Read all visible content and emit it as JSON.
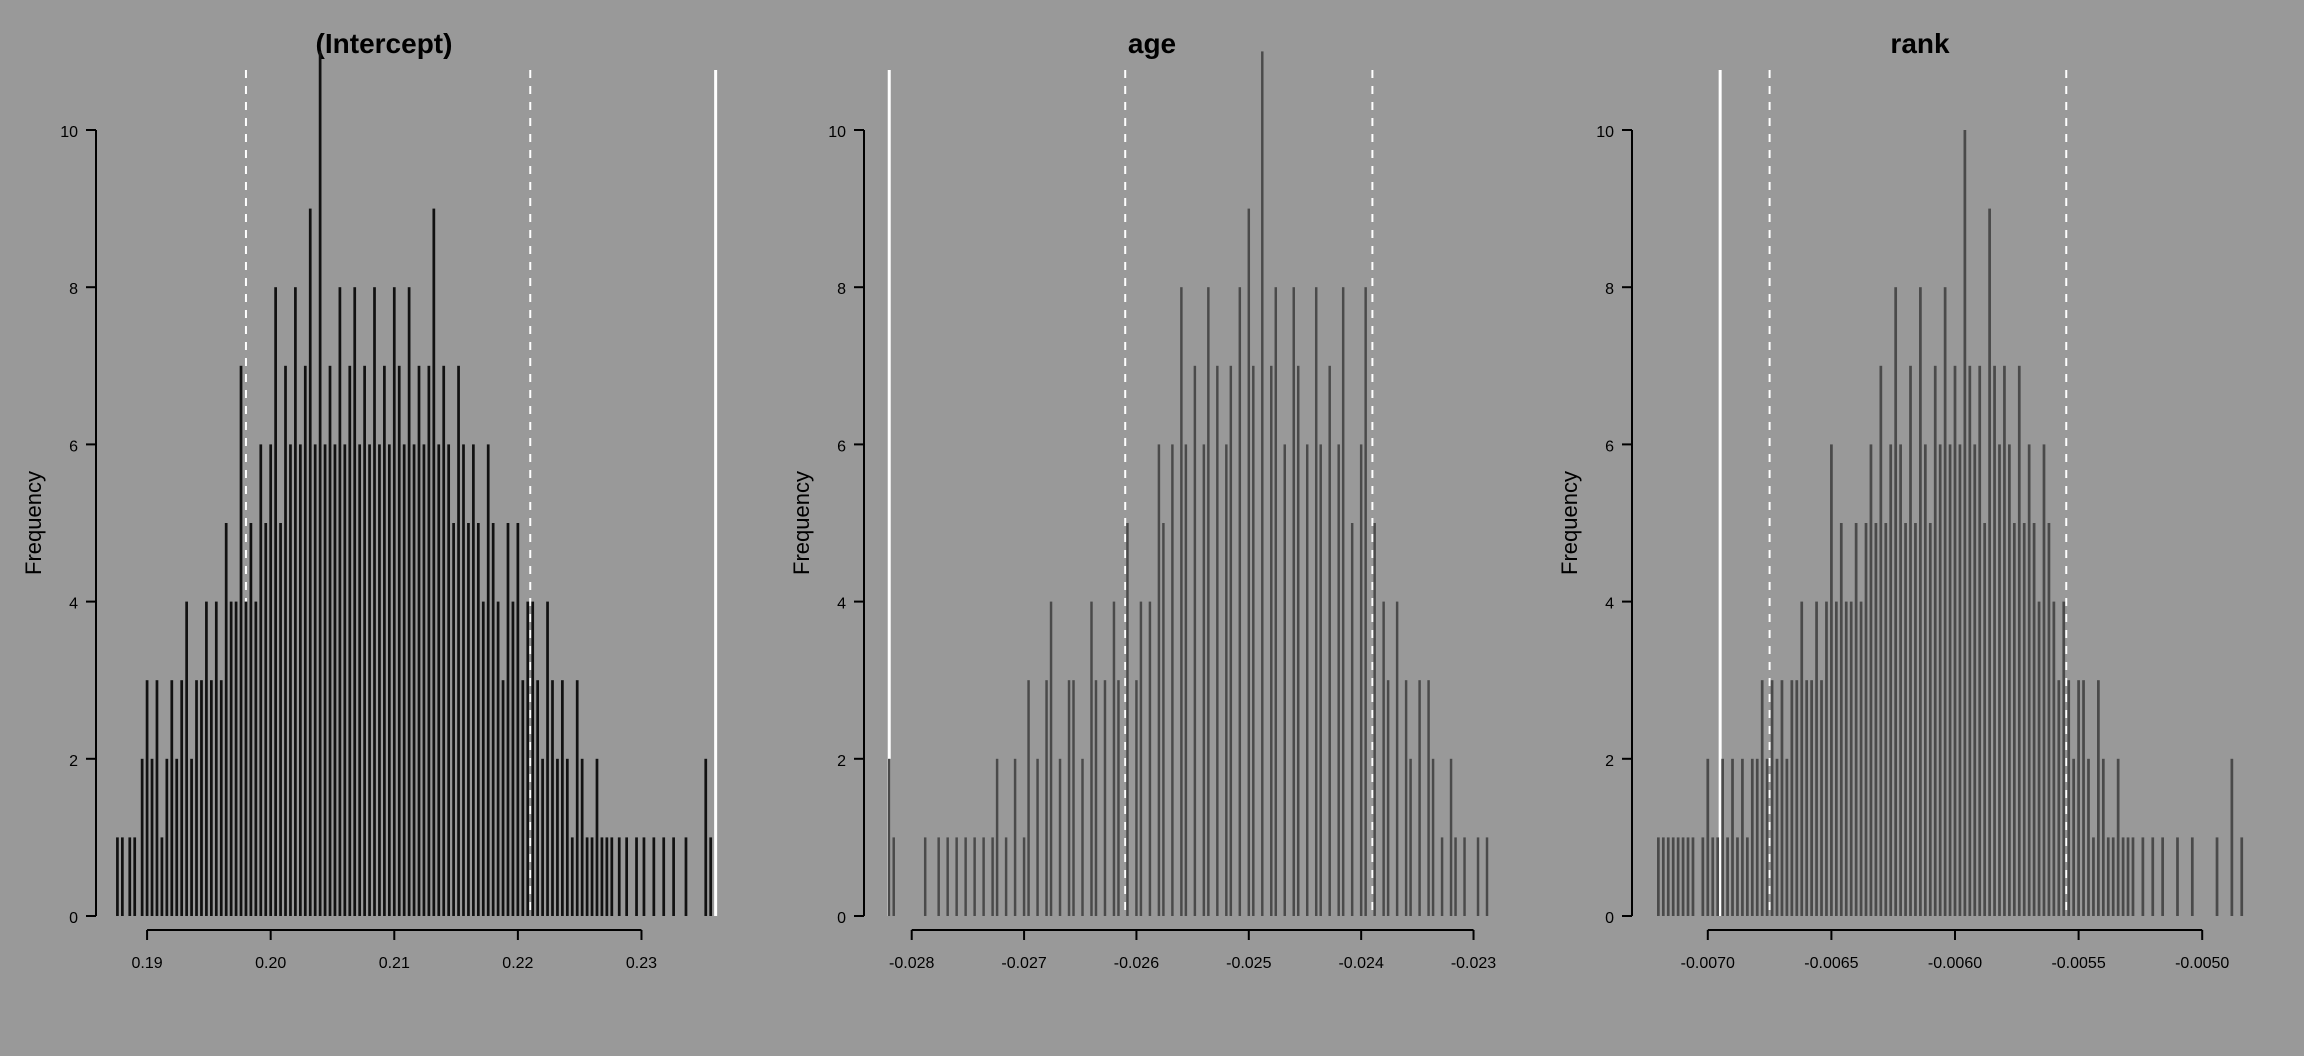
{
  "chart_data": [
    {
      "type": "histogram",
      "title": "(Intercept)",
      "ylabel": "Frequency",
      "ylim": [
        0,
        10
      ],
      "y_ticks": [
        0,
        2,
        4,
        6,
        8,
        10
      ],
      "xlim": [
        0.187,
        0.237
      ],
      "x_ticks": [
        0.19,
        0.2,
        0.21,
        0.22,
        0.23
      ],
      "x_tick_labels": [
        "0.19",
        "0.20",
        "0.21",
        "0.22",
        "0.23"
      ],
      "ref_solid": [
        0.236
      ],
      "ref_dash": [
        0.198,
        0.221
      ],
      "bar_fill": "dark",
      "bars": [
        {
          "x": 0.1876,
          "h": 1
        },
        {
          "x": 0.188,
          "h": 1
        },
        {
          "x": 0.1886,
          "h": 1
        },
        {
          "x": 0.189,
          "h": 1
        },
        {
          "x": 0.1896,
          "h": 2
        },
        {
          "x": 0.19,
          "h": 3
        },
        {
          "x": 0.1904,
          "h": 2
        },
        {
          "x": 0.1908,
          "h": 3
        },
        {
          "x": 0.1912,
          "h": 1
        },
        {
          "x": 0.1916,
          "h": 2
        },
        {
          "x": 0.192,
          "h": 3
        },
        {
          "x": 0.1924,
          "h": 2
        },
        {
          "x": 0.1928,
          "h": 3
        },
        {
          "x": 0.1932,
          "h": 4
        },
        {
          "x": 0.1936,
          "h": 2
        },
        {
          "x": 0.194,
          "h": 3
        },
        {
          "x": 0.1944,
          "h": 3
        },
        {
          "x": 0.1948,
          "h": 4
        },
        {
          "x": 0.1952,
          "h": 3
        },
        {
          "x": 0.1956,
          "h": 4
        },
        {
          "x": 0.196,
          "h": 3
        },
        {
          "x": 0.1964,
          "h": 5
        },
        {
          "x": 0.1968,
          "h": 4
        },
        {
          "x": 0.1972,
          "h": 4
        },
        {
          "x": 0.1976,
          "h": 7
        },
        {
          "x": 0.198,
          "h": 4
        },
        {
          "x": 0.1984,
          "h": 5
        },
        {
          "x": 0.1988,
          "h": 4
        },
        {
          "x": 0.1992,
          "h": 6
        },
        {
          "x": 0.1996,
          "h": 5
        },
        {
          "x": 0.2,
          "h": 6
        },
        {
          "x": 0.2004,
          "h": 8
        },
        {
          "x": 0.2008,
          "h": 5
        },
        {
          "x": 0.2012,
          "h": 7
        },
        {
          "x": 0.2016,
          "h": 6
        },
        {
          "x": 0.202,
          "h": 8
        },
        {
          "x": 0.2024,
          "h": 6
        },
        {
          "x": 0.2028,
          "h": 7
        },
        {
          "x": 0.2032,
          "h": 9
        },
        {
          "x": 0.2036,
          "h": 6
        },
        {
          "x": 0.204,
          "h": 11
        },
        {
          "x": 0.2044,
          "h": 6
        },
        {
          "x": 0.2048,
          "h": 7
        },
        {
          "x": 0.2052,
          "h": 6
        },
        {
          "x": 0.2056,
          "h": 8
        },
        {
          "x": 0.206,
          "h": 6
        },
        {
          "x": 0.2064,
          "h": 7
        },
        {
          "x": 0.2068,
          "h": 8
        },
        {
          "x": 0.2072,
          "h": 6
        },
        {
          "x": 0.2076,
          "h": 7
        },
        {
          "x": 0.208,
          "h": 6
        },
        {
          "x": 0.2084,
          "h": 8
        },
        {
          "x": 0.2088,
          "h": 6
        },
        {
          "x": 0.2092,
          "h": 7
        },
        {
          "x": 0.2096,
          "h": 6
        },
        {
          "x": 0.21,
          "h": 8
        },
        {
          "x": 0.2104,
          "h": 7
        },
        {
          "x": 0.2108,
          "h": 6
        },
        {
          "x": 0.2112,
          "h": 8
        },
        {
          "x": 0.2116,
          "h": 6
        },
        {
          "x": 0.212,
          "h": 7
        },
        {
          "x": 0.2124,
          "h": 6
        },
        {
          "x": 0.2128,
          "h": 7
        },
        {
          "x": 0.2132,
          "h": 9
        },
        {
          "x": 0.2136,
          "h": 6
        },
        {
          "x": 0.214,
          "h": 7
        },
        {
          "x": 0.2144,
          "h": 6
        },
        {
          "x": 0.2148,
          "h": 5
        },
        {
          "x": 0.2152,
          "h": 7
        },
        {
          "x": 0.2156,
          "h": 6
        },
        {
          "x": 0.216,
          "h": 5
        },
        {
          "x": 0.2164,
          "h": 6
        },
        {
          "x": 0.2168,
          "h": 5
        },
        {
          "x": 0.2172,
          "h": 4
        },
        {
          "x": 0.2176,
          "h": 6
        },
        {
          "x": 0.218,
          "h": 5
        },
        {
          "x": 0.2184,
          "h": 4
        },
        {
          "x": 0.2188,
          "h": 3
        },
        {
          "x": 0.2192,
          "h": 5
        },
        {
          "x": 0.2196,
          "h": 4
        },
        {
          "x": 0.22,
          "h": 5
        },
        {
          "x": 0.2204,
          "h": 3
        },
        {
          "x": 0.2208,
          "h": 4
        },
        {
          "x": 0.2212,
          "h": 4
        },
        {
          "x": 0.2216,
          "h": 3
        },
        {
          "x": 0.222,
          "h": 2
        },
        {
          "x": 0.2224,
          "h": 4
        },
        {
          "x": 0.2228,
          "h": 3
        },
        {
          "x": 0.2232,
          "h": 2
        },
        {
          "x": 0.2236,
          "h": 3
        },
        {
          "x": 0.224,
          "h": 2
        },
        {
          "x": 0.2244,
          "h": 1
        },
        {
          "x": 0.2248,
          "h": 3
        },
        {
          "x": 0.2252,
          "h": 2
        },
        {
          "x": 0.2256,
          "h": 1
        },
        {
          "x": 0.226,
          "h": 1
        },
        {
          "x": 0.2264,
          "h": 2
        },
        {
          "x": 0.2268,
          "h": 1
        },
        {
          "x": 0.2272,
          "h": 1
        },
        {
          "x": 0.2276,
          "h": 1
        },
        {
          "x": 0.2282,
          "h": 1
        },
        {
          "x": 0.2288,
          "h": 1
        },
        {
          "x": 0.2296,
          "h": 1
        },
        {
          "x": 0.2302,
          "h": 1
        },
        {
          "x": 0.231,
          "h": 1
        },
        {
          "x": 0.2318,
          "h": 1
        },
        {
          "x": 0.2326,
          "h": 1
        },
        {
          "x": 0.2336,
          "h": 1
        },
        {
          "x": 0.2352,
          "h": 2
        },
        {
          "x": 0.2356,
          "h": 1
        }
      ]
    },
    {
      "type": "histogram",
      "title": "age",
      "ylabel": "Frequency",
      "ylim": [
        0,
        10
      ],
      "y_ticks": [
        0,
        2,
        4,
        6,
        8,
        10
      ],
      "xlim": [
        -0.0283,
        -0.0228
      ],
      "x_ticks": [
        -0.028,
        -0.027,
        -0.026,
        -0.025,
        -0.024,
        -0.023
      ],
      "x_tick_labels": [
        "-0.028",
        "-0.027",
        "-0.026",
        "-0.025",
        "-0.024",
        "-0.023"
      ],
      "ref_solid": [
        -0.0282
      ],
      "ref_dash": [
        -0.0261,
        -0.0239
      ],
      "bar_fill": "normal",
      "bars": [
        {
          "x": -0.0282,
          "h": 2
        },
        {
          "x": -0.02816,
          "h": 1
        },
        {
          "x": -0.02788,
          "h": 1
        },
        {
          "x": -0.02776,
          "h": 1
        },
        {
          "x": -0.02768,
          "h": 1
        },
        {
          "x": -0.0276,
          "h": 1
        },
        {
          "x": -0.02752,
          "h": 1
        },
        {
          "x": -0.02744,
          "h": 1
        },
        {
          "x": -0.02736,
          "h": 1
        },
        {
          "x": -0.02728,
          "h": 1
        },
        {
          "x": -0.02724,
          "h": 2
        },
        {
          "x": -0.02716,
          "h": 1
        },
        {
          "x": -0.02708,
          "h": 2
        },
        {
          "x": -0.027,
          "h": 1
        },
        {
          "x": -0.02696,
          "h": 3
        },
        {
          "x": -0.02688,
          "h": 2
        },
        {
          "x": -0.0268,
          "h": 3
        },
        {
          "x": -0.02676,
          "h": 4
        },
        {
          "x": -0.02668,
          "h": 2
        },
        {
          "x": -0.0266,
          "h": 3
        },
        {
          "x": -0.02656,
          "h": 3
        },
        {
          "x": -0.02648,
          "h": 2
        },
        {
          "x": -0.0264,
          "h": 4
        },
        {
          "x": -0.02636,
          "h": 3
        },
        {
          "x": -0.02628,
          "h": 3
        },
        {
          "x": -0.0262,
          "h": 4
        },
        {
          "x": -0.02616,
          "h": 3
        },
        {
          "x": -0.02608,
          "h": 5
        },
        {
          "x": -0.026,
          "h": 3
        },
        {
          "x": -0.02596,
          "h": 4
        },
        {
          "x": -0.02588,
          "h": 4
        },
        {
          "x": -0.0258,
          "h": 6
        },
        {
          "x": -0.02576,
          "h": 5
        },
        {
          "x": -0.02568,
          "h": 6
        },
        {
          "x": -0.0256,
          "h": 8
        },
        {
          "x": -0.02556,
          "h": 6
        },
        {
          "x": -0.02548,
          "h": 7
        },
        {
          "x": -0.0254,
          "h": 6
        },
        {
          "x": -0.02536,
          "h": 8
        },
        {
          "x": -0.02528,
          "h": 7
        },
        {
          "x": -0.0252,
          "h": 6
        },
        {
          "x": -0.02516,
          "h": 7
        },
        {
          "x": -0.02508,
          "h": 8
        },
        {
          "x": -0.025,
          "h": 9
        },
        {
          "x": -0.02496,
          "h": 7
        },
        {
          "x": -0.02488,
          "h": 11
        },
        {
          "x": -0.0248,
          "h": 7
        },
        {
          "x": -0.02476,
          "h": 8
        },
        {
          "x": -0.02468,
          "h": 6
        },
        {
          "x": -0.0246,
          "h": 8
        },
        {
          "x": -0.02456,
          "h": 7
        },
        {
          "x": -0.02448,
          "h": 6
        },
        {
          "x": -0.0244,
          "h": 8
        },
        {
          "x": -0.02436,
          "h": 6
        },
        {
          "x": -0.02428,
          "h": 7
        },
        {
          "x": -0.0242,
          "h": 6
        },
        {
          "x": -0.02416,
          "h": 8
        },
        {
          "x": -0.02408,
          "h": 5
        },
        {
          "x": -0.024,
          "h": 6
        },
        {
          "x": -0.02396,
          "h": 8
        },
        {
          "x": -0.02388,
          "h": 5
        },
        {
          "x": -0.0238,
          "h": 4
        },
        {
          "x": -0.02376,
          "h": 3
        },
        {
          "x": -0.02368,
          "h": 4
        },
        {
          "x": -0.0236,
          "h": 3
        },
        {
          "x": -0.02356,
          "h": 2
        },
        {
          "x": -0.02348,
          "h": 3
        },
        {
          "x": -0.0234,
          "h": 3
        },
        {
          "x": -0.02336,
          "h": 2
        },
        {
          "x": -0.02328,
          "h": 1
        },
        {
          "x": -0.0232,
          "h": 2
        },
        {
          "x": -0.02316,
          "h": 1
        },
        {
          "x": -0.02308,
          "h": 1
        },
        {
          "x": -0.02296,
          "h": 1
        },
        {
          "x": -0.02288,
          "h": 1
        }
      ]
    },
    {
      "type": "histogram",
      "title": "rank",
      "ylabel": "Frequency",
      "ylim": [
        0,
        10
      ],
      "y_ticks": [
        0,
        2,
        4,
        6,
        8,
        10
      ],
      "xlim": [
        -0.00725,
        -0.00475
      ],
      "x_ticks": [
        -0.007,
        -0.0065,
        -0.006,
        -0.0055,
        -0.005
      ],
      "x_tick_labels": [
        "-0.0070",
        "-0.0065",
        "-0.0060",
        "-0.0055",
        "-0.0050"
      ],
      "ref_solid": [
        -0.00695
      ],
      "ref_dash": [
        -0.00675,
        -0.00555
      ],
      "bar_fill": "normal",
      "bars": [
        {
          "x": -0.0072,
          "h": 1
        },
        {
          "x": -0.00718,
          "h": 1
        },
        {
          "x": -0.00716,
          "h": 1
        },
        {
          "x": -0.00714,
          "h": 1
        },
        {
          "x": -0.00712,
          "h": 1
        },
        {
          "x": -0.0071,
          "h": 1
        },
        {
          "x": -0.00708,
          "h": 1
        },
        {
          "x": -0.00706,
          "h": 1
        },
        {
          "x": -0.00702,
          "h": 1
        },
        {
          "x": -0.007,
          "h": 2
        },
        {
          "x": -0.00698,
          "h": 1
        },
        {
          "x": -0.00696,
          "h": 1
        },
        {
          "x": -0.00694,
          "h": 2
        },
        {
          "x": -0.00692,
          "h": 1
        },
        {
          "x": -0.0069,
          "h": 2
        },
        {
          "x": -0.00688,
          "h": 1
        },
        {
          "x": -0.00686,
          "h": 2
        },
        {
          "x": -0.00684,
          "h": 1
        },
        {
          "x": -0.00682,
          "h": 2
        },
        {
          "x": -0.0068,
          "h": 2
        },
        {
          "x": -0.00678,
          "h": 3
        },
        {
          "x": -0.00676,
          "h": 2
        },
        {
          "x": -0.00674,
          "h": 3
        },
        {
          "x": -0.00672,
          "h": 2
        },
        {
          "x": -0.0067,
          "h": 3
        },
        {
          "x": -0.00668,
          "h": 2
        },
        {
          "x": -0.00666,
          "h": 3
        },
        {
          "x": -0.00664,
          "h": 3
        },
        {
          "x": -0.00662,
          "h": 4
        },
        {
          "x": -0.0066,
          "h": 3
        },
        {
          "x": -0.00658,
          "h": 3
        },
        {
          "x": -0.00656,
          "h": 4
        },
        {
          "x": -0.00654,
          "h": 3
        },
        {
          "x": -0.00652,
          "h": 4
        },
        {
          "x": -0.0065,
          "h": 6
        },
        {
          "x": -0.00648,
          "h": 4
        },
        {
          "x": -0.00646,
          "h": 5
        },
        {
          "x": -0.00644,
          "h": 4
        },
        {
          "x": -0.00642,
          "h": 4
        },
        {
          "x": -0.0064,
          "h": 5
        },
        {
          "x": -0.00638,
          "h": 4
        },
        {
          "x": -0.00636,
          "h": 5
        },
        {
          "x": -0.00634,
          "h": 6
        },
        {
          "x": -0.00632,
          "h": 5
        },
        {
          "x": -0.0063,
          "h": 7
        },
        {
          "x": -0.00628,
          "h": 5
        },
        {
          "x": -0.00626,
          "h": 6
        },
        {
          "x": -0.00624,
          "h": 8
        },
        {
          "x": -0.00622,
          "h": 6
        },
        {
          "x": -0.0062,
          "h": 5
        },
        {
          "x": -0.00618,
          "h": 7
        },
        {
          "x": -0.00616,
          "h": 5
        },
        {
          "x": -0.00614,
          "h": 8
        },
        {
          "x": -0.00612,
          "h": 6
        },
        {
          "x": -0.0061,
          "h": 5
        },
        {
          "x": -0.00608,
          "h": 7
        },
        {
          "x": -0.00606,
          "h": 6
        },
        {
          "x": -0.00604,
          "h": 8
        },
        {
          "x": -0.00602,
          "h": 6
        },
        {
          "x": -0.006,
          "h": 7
        },
        {
          "x": -0.00598,
          "h": 6
        },
        {
          "x": -0.00596,
          "h": 10
        },
        {
          "x": -0.00594,
          "h": 7
        },
        {
          "x": -0.00592,
          "h": 6
        },
        {
          "x": -0.0059,
          "h": 7
        },
        {
          "x": -0.00588,
          "h": 5
        },
        {
          "x": -0.00586,
          "h": 9
        },
        {
          "x": -0.00584,
          "h": 7
        },
        {
          "x": -0.00582,
          "h": 6
        },
        {
          "x": -0.0058,
          "h": 7
        },
        {
          "x": -0.00578,
          "h": 6
        },
        {
          "x": -0.00576,
          "h": 5
        },
        {
          "x": -0.00574,
          "h": 7
        },
        {
          "x": -0.00572,
          "h": 5
        },
        {
          "x": -0.0057,
          "h": 6
        },
        {
          "x": -0.00568,
          "h": 5
        },
        {
          "x": -0.00566,
          "h": 4
        },
        {
          "x": -0.00564,
          "h": 6
        },
        {
          "x": -0.00562,
          "h": 5
        },
        {
          "x": -0.0056,
          "h": 4
        },
        {
          "x": -0.00558,
          "h": 3
        },
        {
          "x": -0.00556,
          "h": 4
        },
        {
          "x": -0.00554,
          "h": 3
        },
        {
          "x": -0.00552,
          "h": 2
        },
        {
          "x": -0.0055,
          "h": 3
        },
        {
          "x": -0.00548,
          "h": 3
        },
        {
          "x": -0.00546,
          "h": 2
        },
        {
          "x": -0.00544,
          "h": 1
        },
        {
          "x": -0.00542,
          "h": 3
        },
        {
          "x": -0.0054,
          "h": 2
        },
        {
          "x": -0.00538,
          "h": 1
        },
        {
          "x": -0.00536,
          "h": 1
        },
        {
          "x": -0.00534,
          "h": 2
        },
        {
          "x": -0.00532,
          "h": 1
        },
        {
          "x": -0.0053,
          "h": 1
        },
        {
          "x": -0.00528,
          "h": 1
        },
        {
          "x": -0.00524,
          "h": 1
        },
        {
          "x": -0.0052,
          "h": 1
        },
        {
          "x": -0.00516,
          "h": 1
        },
        {
          "x": -0.0051,
          "h": 1
        },
        {
          "x": -0.00504,
          "h": 1
        },
        {
          "x": -0.00494,
          "h": 1
        },
        {
          "x": -0.00488,
          "h": 2
        },
        {
          "x": -0.00484,
          "h": 1
        }
      ]
    }
  ]
}
